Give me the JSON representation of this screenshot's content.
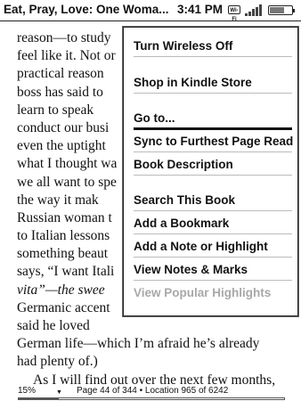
{
  "status_bar": {
    "book_title": "Eat, Pray, Love: One Woma...",
    "time": "3:41 PM",
    "wifi_label": "Wi-Fi",
    "icons": [
      "wifi-icon",
      "signal-strength-icon",
      "battery-icon"
    ],
    "battery_level": 0.7,
    "signal_level": 1.0
  },
  "page_text": [
    "reason—to study",
    "feel like it. Not or",
    "practical reason",
    "boss has said to",
    "learn to speak",
    "conduct our busi",
    "even the uptight",
    "what I thought wa",
    "we all want to spe",
    "the way it mak",
    "Russian woman t",
    "to Italian lessons",
    "something beaut",
    "says, “I want Itali",
    "vita”—the swee",
    "Germanic accent",
    "said he loved",
    "German life—which I’m afraid he’s already",
    "had plenty of.)",
    "As I will find out over the next few months,"
  ],
  "menu": {
    "items": [
      {
        "label": "Turn Wireless Off",
        "enabled": true
      },
      {
        "label": "Shop in Kindle Store",
        "enabled": true
      },
      {
        "label": "Go to...",
        "enabled": true
      },
      {
        "label": "Sync to Furthest Page Read",
        "enabled": true
      },
      {
        "label": "Book Description",
        "enabled": true
      },
      {
        "label": "Search This Book",
        "enabled": true
      },
      {
        "label": "Add a Bookmark",
        "enabled": true
      },
      {
        "label": "Add a Note or Highlight",
        "enabled": true
      },
      {
        "label": "View Notes & Marks",
        "enabled": true
      },
      {
        "label": "View Popular Highlights",
        "enabled": false
      }
    ]
  },
  "footer": {
    "percent": "15%",
    "location_text": "Page 44 of 344 • Location 965 of 6242",
    "progress": 0.15
  }
}
